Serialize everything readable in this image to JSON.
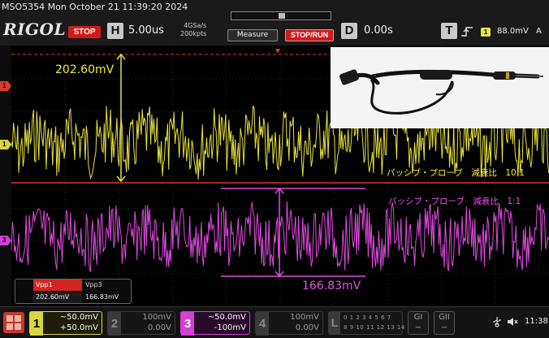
{
  "header": {
    "device_title": "MSO5354  Mon October 21 11:39:20 2024",
    "logo": "RIGOL",
    "run_state": "STOP",
    "horizontal": {
      "letter": "H",
      "timebase": "5.00us",
      "sample_rate": "4GSa/s",
      "memory_depth": "200kpts"
    },
    "measure_label": "Measure",
    "stop_run_label": "STOP/RUN",
    "delay": {
      "letter": "D",
      "value": "0.00s"
    },
    "trigger": {
      "letter": "T",
      "slope_icon": "rising-edge-icon",
      "source": "1",
      "level": "88.0mV",
      "mode": "A"
    }
  },
  "plot": {
    "channel_markers": [
      "1",
      "1",
      "3"
    ],
    "annotations": {
      "top_amplitude": "202.60mV",
      "bottom_amplitude": "166.83mV",
      "probe_10x": "パッシブ・プローブ　減衰比　10:1",
      "probe_1x": "パッシブ・プローブ　減衰比　1:1"
    },
    "trace_colors": {
      "ch1": "#e6e23a",
      "ch3": "#e04ae0",
      "ref": "#e0352a"
    }
  },
  "measurements": {
    "headers": [
      "Vpp1",
      "Vpp3"
    ],
    "values": [
      "202.60mV",
      "166.83mV"
    ]
  },
  "bottom": {
    "channels": [
      {
        "num": "1",
        "scale": "~50.0mV",
        "offset": "+50.0mV",
        "active": true
      },
      {
        "num": "2",
        "scale": "100mV",
        "offset": "0.00V",
        "active": false
      },
      {
        "num": "3",
        "scale": "~50.0mV",
        "offset": "-100mV",
        "active": true
      },
      {
        "num": "4",
        "scale": "100mV",
        "offset": "0.00V",
        "active": false
      }
    ],
    "logic": {
      "letter": "L",
      "row1": "0 1 2 3 4 5 6 7",
      "row2": "8 9 10 11 12 13 14 15"
    },
    "generators": [
      {
        "label": "GI",
        "sub": "~"
      },
      {
        "label": "GII",
        "sub": "~"
      }
    ],
    "time": "11:38"
  }
}
